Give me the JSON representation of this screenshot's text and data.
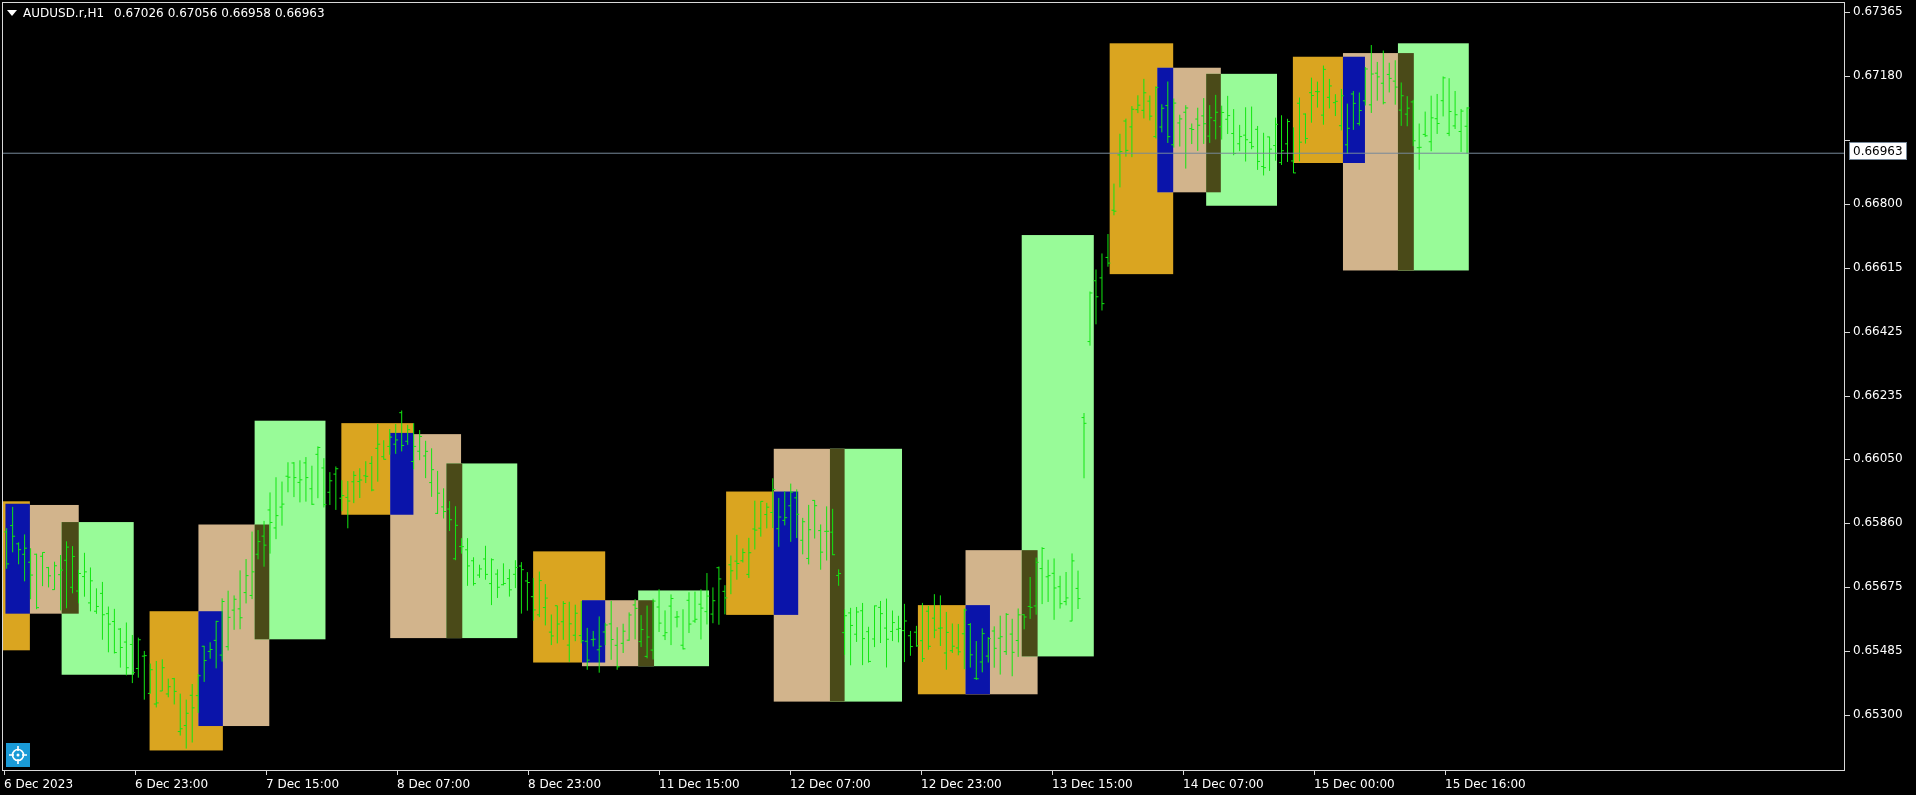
{
  "chart_header": {
    "symbol": "AUDUSD.r,H1",
    "quotes": [
      "0.67026",
      "0.67056",
      "0.66958",
      "0.66963"
    ]
  },
  "price_axis": {
    "upper_labels": [
      "0.67365",
      "0.67180"
    ],
    "lower_labels": [
      "0.66800",
      "0.66615",
      "0.66425",
      "0.66235",
      "0.66050",
      "0.65860",
      "0.65675",
      "0.65485",
      "0.65300"
    ],
    "current_price": "0.66963"
  },
  "time_axis": {
    "labels": [
      "6 Dec 2023",
      "6 Dec 23:00",
      "7 Dec 15:00",
      "8 Dec 07:00",
      "8 Dec 23:00",
      "11 Dec 15:00",
      "12 Dec 07:00",
      "12 Dec 23:00",
      "13 Dec 15:00",
      "14 Dec 07:00",
      "15 Dec 00:00",
      "15 Dec 16:00"
    ]
  }
}
